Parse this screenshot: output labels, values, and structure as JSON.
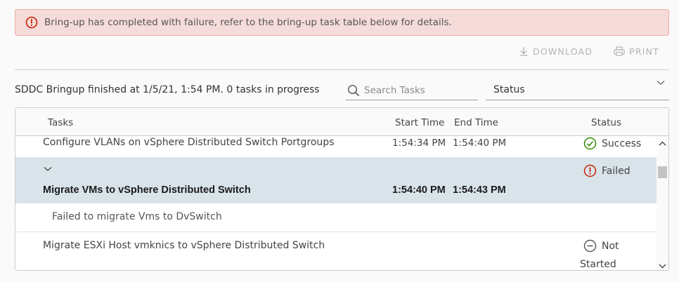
{
  "alert": {
    "icon": "error-circle-icon",
    "message": "Bring-up has completed with failure, refer to the bring-up task table below for details.",
    "color": "#c92100"
  },
  "actions": {
    "download_label": "DOWNLOAD",
    "print_label": "PRINT"
  },
  "summary": {
    "text": "SDDC Bringup finished at 1/5/21, 1:54 PM. 0 tasks in progress"
  },
  "search": {
    "placeholder": "Search Tasks",
    "value": ""
  },
  "status_filter": {
    "value": "Status"
  },
  "table": {
    "columns": {
      "tasks": "Tasks",
      "start": "Start Time",
      "end": "End Time",
      "status": "Status"
    },
    "rows": [
      {
        "task": "Configure VLANs on vSphere Distributed Switch Portgroups",
        "start": "1:54:34 PM",
        "end": "1:54:40 PM",
        "status": "Success",
        "status_icon": "success-check-icon",
        "status_color": "#318700"
      },
      {
        "task": "Migrate VMs to vSphere Distributed Switch",
        "start": "1:54:40 PM",
        "end": "1:54:43 PM",
        "status": "Failed",
        "status_icon": "failed-error-icon",
        "status_color": "#c92100",
        "expanded": true,
        "detail": "Failed to migrate Vms to DvSwitch"
      },
      {
        "task": "Migrate ESXi Host vmknics to vSphere Distributed Switch",
        "start": "",
        "end": "",
        "status_line1": "Not",
        "status_line2": "Started",
        "status_icon": "not-started-minus-icon",
        "status_color": "#565656"
      }
    ]
  }
}
